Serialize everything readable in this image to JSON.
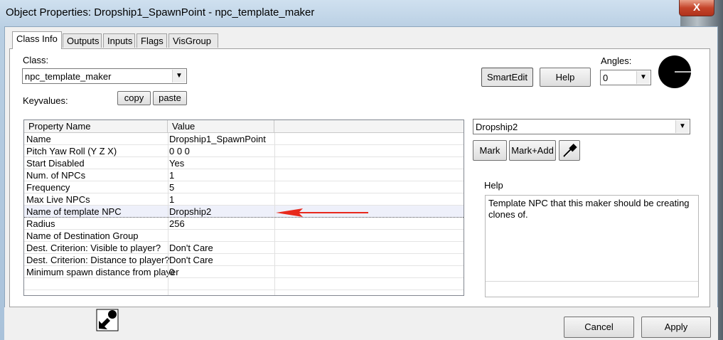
{
  "window": {
    "title": "Object Properties: Dropship1_SpawnPoint - npc_template_maker",
    "close_glyph": "X"
  },
  "tabs": [
    {
      "label": "Class Info",
      "active": true
    },
    {
      "label": "Outputs"
    },
    {
      "label": "Inputs"
    },
    {
      "label": "Flags"
    },
    {
      "label": "VisGroup"
    }
  ],
  "class_label": "Class:",
  "class_value": "npc_template_maker",
  "keyvalues_label": "Keyvalues:",
  "copy_label": "copy",
  "paste_label": "paste",
  "smartedit_label": "SmartEdit",
  "help_button_label": "Help",
  "angles_label": "Angles:",
  "angles_value": "0",
  "table": {
    "headers": [
      "Property Name",
      "Value"
    ],
    "rows": [
      {
        "name": "Name",
        "value": "Dropship1_SpawnPoint"
      },
      {
        "name": "Pitch Yaw Roll (Y Z X)",
        "value": "0 0 0"
      },
      {
        "name": "Start Disabled",
        "value": "Yes"
      },
      {
        "name": "Num. of NPCs",
        "value": "1"
      },
      {
        "name": "Frequency",
        "value": "5"
      },
      {
        "name": "Max Live NPCs",
        "value": "1"
      },
      {
        "name": "Name of template NPC",
        "value": "Dropship2"
      },
      {
        "name": "Radius",
        "value": "256"
      },
      {
        "name": "Name of Destination Group",
        "value": ""
      },
      {
        "name": "Dest. Criterion: Visible to player?",
        "value": "Don't Care"
      },
      {
        "name": "Dest. Criterion: Distance to player?",
        "value": "Don't Care"
      },
      {
        "name": "Minimum spawn distance from player",
        "value": "0"
      }
    ],
    "selected_row": 6
  },
  "value_combo": "Dropship2",
  "mark_label": "Mark",
  "markadd_label": "Mark+Add",
  "help_section_label": "Help",
  "help_text": "Template NPC that this maker should be creating clones of.",
  "cancel_label": "Cancel",
  "apply_label": "Apply",
  "colors": {
    "annotation_arrow": "#e8291c",
    "selection": "#eef0fa"
  }
}
